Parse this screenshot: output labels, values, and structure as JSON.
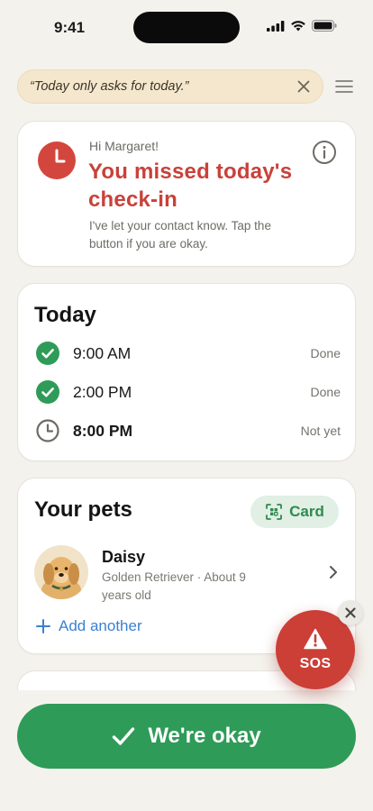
{
  "status_bar": {
    "time": "9:41"
  },
  "quote": {
    "text": "“Today only asks for today.”"
  },
  "alert": {
    "greeting": "Hi Margaret!",
    "title": "You missed today's check-in",
    "body": "I've let your contact know. Tap the button if you are okay."
  },
  "today": {
    "title": "Today",
    "checkins": [
      {
        "time": "9:00 AM",
        "status": "Done",
        "icon": "check-circle-icon"
      },
      {
        "time": "2:00 PM",
        "status": "Done",
        "icon": "check-circle-icon"
      },
      {
        "time": "8:00 PM",
        "status": "Not yet",
        "icon": "clock-icon"
      }
    ]
  },
  "pets": {
    "title": "Your pets",
    "card_button": "Card",
    "items": [
      {
        "name": "Daisy",
        "description": "Golden Retriever · About 9 years old"
      }
    ],
    "add_label": "Add another"
  },
  "sos": {
    "label": "SOS"
  },
  "okay_button": {
    "label": "We're okay"
  },
  "colors": {
    "alert_red": "#c9413a",
    "success_green": "#2f9b58",
    "link_blue": "#3a7fd6",
    "banner_bg": "#f5e7cd"
  }
}
